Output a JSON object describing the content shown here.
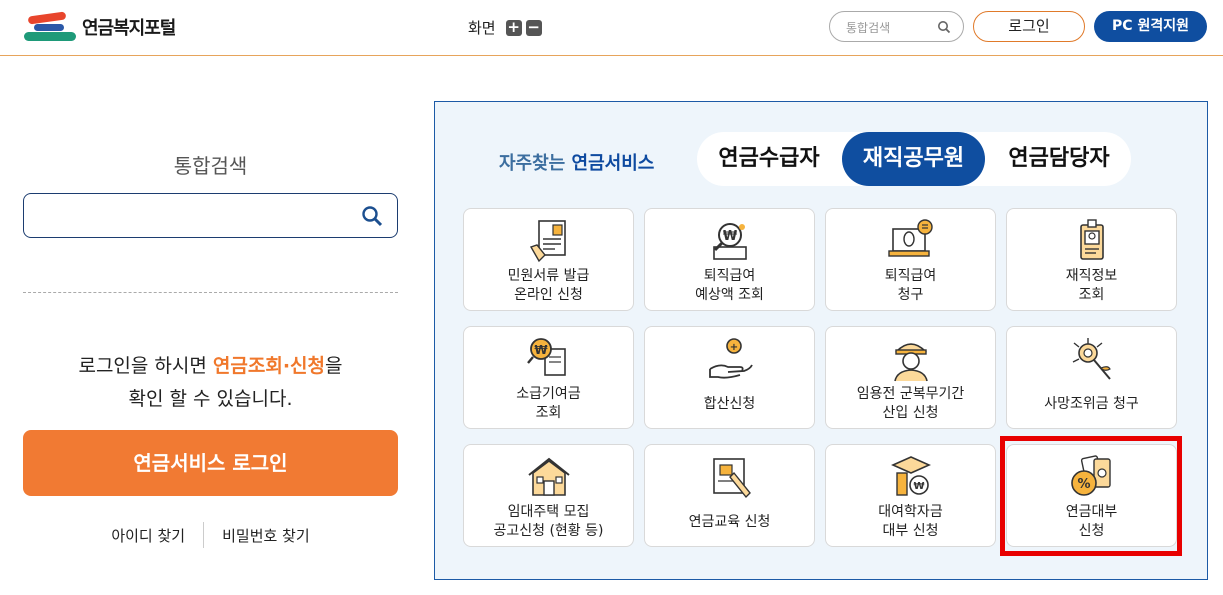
{
  "header": {
    "logo_text": "연금복지포털",
    "zoom_label": "화면",
    "zoom_in": "+",
    "zoom_out": "−",
    "search_placeholder": "통합검색",
    "login_label": "로그인",
    "remote_label": "PC 원격지원"
  },
  "left": {
    "search_title": "통합검색",
    "login_msg_pre": "로그인을 하시면 ",
    "login_msg_highlight": "연금조회·신청",
    "login_msg_post": "을",
    "login_msg_line2": "확인 할 수 있습니다.",
    "login_button": "연금서비스 로그인",
    "find_id": "아이디 찾기",
    "find_pw": "비밀번호 찾기"
  },
  "panel": {
    "freq_pre": "자주찾는 ",
    "freq_bold": "연금서비스",
    "tabs": [
      "연금수급자",
      "재직공무원",
      "연금담당자"
    ],
    "active_tab": "재직공무원",
    "cards": [
      {
        "label": "민원서류 발급\n온라인 신청",
        "icon": "document-certificate-icon"
      },
      {
        "label": "퇴직급여\n예상액 조회",
        "icon": "won-magnifier-icon"
      },
      {
        "label": "퇴직급여\n청구",
        "icon": "laptop-mouse-icon"
      },
      {
        "label": "재직정보\n조회",
        "icon": "id-badge-icon"
      },
      {
        "label": "소급기여금\n조회",
        "icon": "won-search-doc-icon"
      },
      {
        "label": "합산신청",
        "icon": "hand-coin-icon"
      },
      {
        "label": "임용전 군복무기간\n산입 신청",
        "icon": "soldier-icon"
      },
      {
        "label": "사망조위금 청구",
        "icon": "chrysanthemum-icon"
      },
      {
        "label": "임대주택 모집\n공고신청 (현황 등)",
        "icon": "house-icon"
      },
      {
        "label": "연금교육 신청",
        "icon": "education-pen-icon"
      },
      {
        "label": "대여학자금\n대부 신청",
        "icon": "graduation-coin-icon"
      },
      {
        "label": "연금대부\n신청",
        "icon": "loan-percent-icon"
      }
    ]
  },
  "colors": {
    "brand_blue": "#0f4ea0",
    "accent_orange": "#f17a33",
    "highlight_red": "#e80000"
  }
}
